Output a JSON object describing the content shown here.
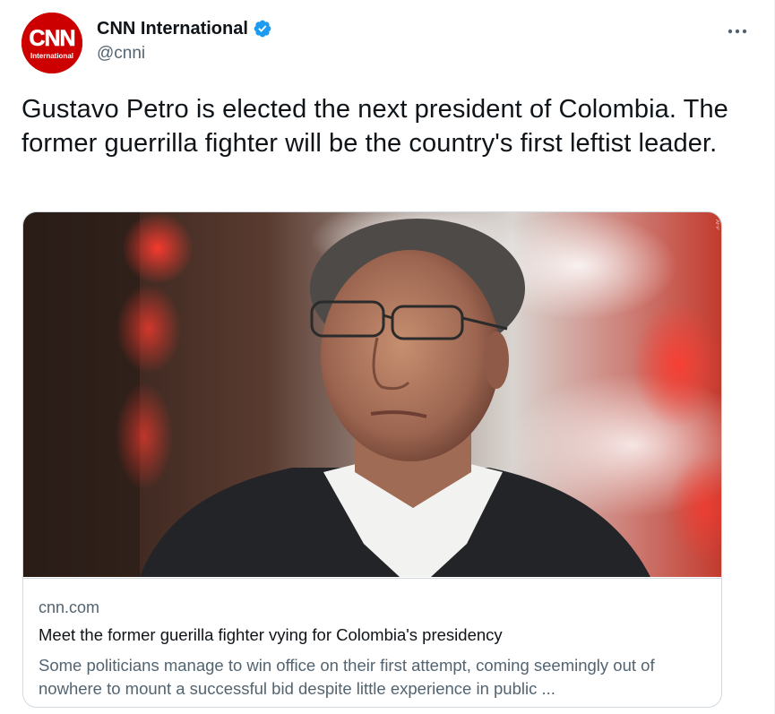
{
  "author": {
    "display_name": "CNN International",
    "handle": "@cnni",
    "avatar_logo_text": "CNN",
    "avatar_sub_text": "International",
    "verified": true
  },
  "tweet": {
    "text": "Gustavo Petro is elected the next president of Colombia. The former guerrilla fighter will be the country's first leftist leader."
  },
  "card": {
    "domain": "cnn.com",
    "title": "Meet the former guerilla fighter vying for Colombia's presidency",
    "description": "Some politicians manage to win office on their first attempt, coming seemingly out of nowhere to mount a successful bid despite little experience in public ..."
  },
  "colors": {
    "cnn_red": "#cc0000",
    "verified_blue": "#1d9bf0",
    "secondary_text": "#536471",
    "border": "#cfd9de"
  },
  "icons": {
    "verified": "verified-badge-icon",
    "more": "more-horizontal-icon"
  }
}
